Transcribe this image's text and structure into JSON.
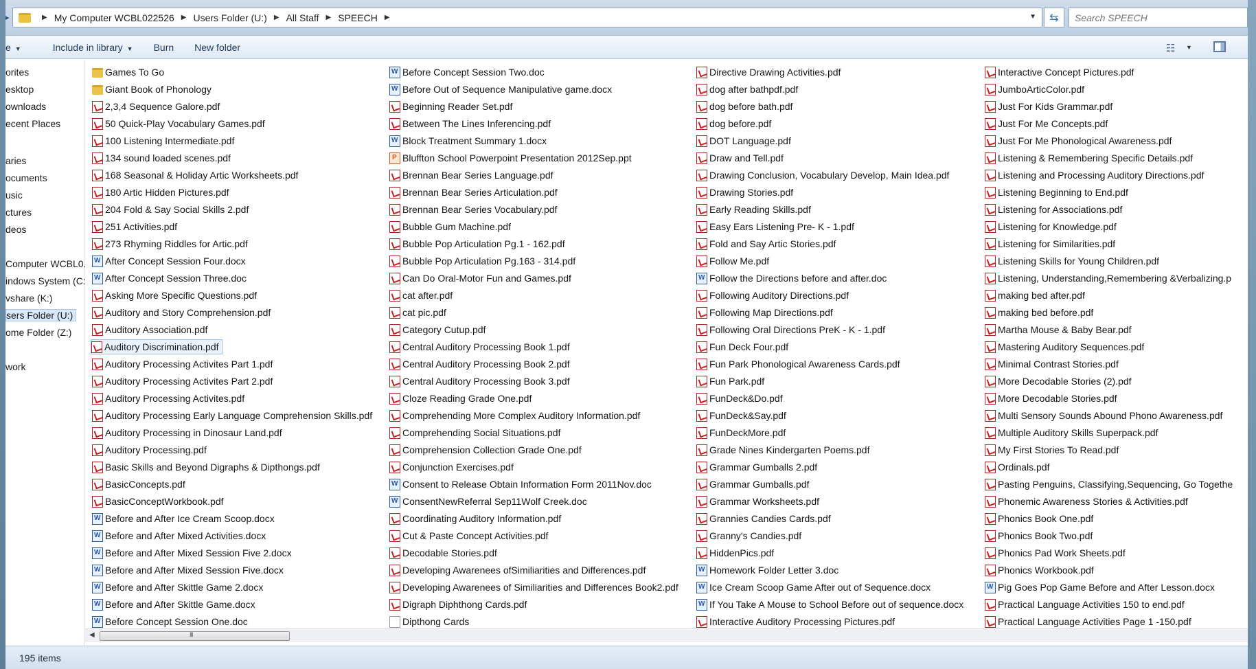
{
  "address": {
    "crumbs": [
      "My Computer WCBL022526",
      "Users Folder (U:)",
      "All Staff",
      "SPEECH"
    ],
    "search_placeholder": "Search SPEECH"
  },
  "toolbar": {
    "organize_label": "e",
    "include_label": "Include in library",
    "burn_label": "Burn",
    "new_folder_label": "New folder"
  },
  "nav": {
    "items": [
      "orites",
      "esktop",
      "ownloads",
      "ecent Places",
      "aries",
      "ocuments",
      "usic",
      "ctures",
      "deos",
      "Computer WCBL0...",
      "indows System (C:",
      "vshare (K:)",
      "sers Folder (U:)",
      "ome Folder (Z:)",
      "work"
    ]
  },
  "columns": [
    [
      {
        "n": "Games To Go",
        "t": "folder"
      },
      {
        "n": "Giant Book of Phonology",
        "t": "folder"
      },
      {
        "n": "2,3,4 Sequence Galore.pdf",
        "t": "pdf"
      },
      {
        "n": "50 Quick-Play Vocabulary Games.pdf",
        "t": "pdf"
      },
      {
        "n": "100 Listening Intermediate.pdf",
        "t": "pdf"
      },
      {
        "n": "134 sound loaded scenes.pdf",
        "t": "pdf"
      },
      {
        "n": "168 Seasonal & Holiday Artic Worksheets.pdf",
        "t": "pdf"
      },
      {
        "n": "180 Artic Hidden Pictures.pdf",
        "t": "pdf"
      },
      {
        "n": "204 Fold & Say Social Skills 2.pdf",
        "t": "pdf"
      },
      {
        "n": "251 Activities.pdf",
        "t": "pdf"
      },
      {
        "n": "273 Rhyming Riddles for Artic.pdf",
        "t": "pdf"
      },
      {
        "n": "After Concept Session Four.docx",
        "t": "doc"
      },
      {
        "n": "After Concept Session Three.doc",
        "t": "doc"
      },
      {
        "n": "Asking More Specific Questions.pdf",
        "t": "pdf"
      },
      {
        "n": "Auditory and Story Comprehension.pdf",
        "t": "pdf"
      },
      {
        "n": "Auditory Association.pdf",
        "t": "pdf"
      },
      {
        "n": "Auditory Discrimination.pdf",
        "t": "pdf",
        "selected": true
      },
      {
        "n": "Auditory Processing Activites Part 1.pdf",
        "t": "pdf"
      },
      {
        "n": "Auditory Processing Activites Part 2.pdf",
        "t": "pdf"
      },
      {
        "n": "Auditory Processing Activites.pdf",
        "t": "pdf"
      },
      {
        "n": "Auditory Processing Early Language Comprehension Skills.pdf",
        "t": "pdf"
      },
      {
        "n": "Auditory Processing in Dinosaur Land.pdf",
        "t": "pdf"
      },
      {
        "n": "Auditory Processing.pdf",
        "t": "pdf"
      },
      {
        "n": "Basic Skills and Beyond Digraphs & Dipthongs.pdf",
        "t": "pdf"
      },
      {
        "n": "BasicConcepts.pdf",
        "t": "pdf"
      },
      {
        "n": "BasicConceptWorkbook.pdf",
        "t": "pdf"
      },
      {
        "n": "Before and After Ice Cream Scoop.docx",
        "t": "doc"
      },
      {
        "n": "Before and After Mixed Activities.docx",
        "t": "doc"
      },
      {
        "n": "Before and After Mixed Session Five 2.docx",
        "t": "doc"
      },
      {
        "n": "Before and After Mixed Session Five.docx",
        "t": "doc"
      },
      {
        "n": "Before and After Skittle Game 2.docx",
        "t": "doc"
      },
      {
        "n": "Before and After Skittle Game.docx",
        "t": "doc"
      },
      {
        "n": "Before Concept Session One.doc",
        "t": "doc"
      }
    ],
    [
      {
        "n": "Before Concept Session Two.doc",
        "t": "doc"
      },
      {
        "n": "Before Out of Sequence Manipulative game.docx",
        "t": "doc"
      },
      {
        "n": "Beginning Reader Set.pdf",
        "t": "pdf"
      },
      {
        "n": "Between The Lines Inferencing.pdf",
        "t": "pdf"
      },
      {
        "n": "Block Treatment Summary 1.docx",
        "t": "doc"
      },
      {
        "n": "Bluffton School Powerpoint Presentation 2012Sep.ppt",
        "t": "ppt"
      },
      {
        "n": "Brennan Bear  Series  Language.pdf",
        "t": "pdf"
      },
      {
        "n": "Brennan Bear Series Articulation.pdf",
        "t": "pdf"
      },
      {
        "n": "Brennan Bear Series Vocabulary.pdf",
        "t": "pdf"
      },
      {
        "n": "Bubble Gum Machine.pdf",
        "t": "pdf"
      },
      {
        "n": "Bubble Pop Articulation Pg.1 - 162.pdf",
        "t": "pdf"
      },
      {
        "n": "Bubble Pop Articulation Pg.163 - 314.pdf",
        "t": "pdf"
      },
      {
        "n": "Can Do Oral-Motor Fun and Games.pdf",
        "t": "pdf"
      },
      {
        "n": "cat after.pdf",
        "t": "pdf"
      },
      {
        "n": "cat pic.pdf",
        "t": "pdf"
      },
      {
        "n": "Category Cutup.pdf",
        "t": "pdf"
      },
      {
        "n": "Central Auditory Processing Book 1.pdf",
        "t": "pdf"
      },
      {
        "n": "Central Auditory Processing Book 2.pdf",
        "t": "pdf"
      },
      {
        "n": "Central Auditory Processing Book 3.pdf",
        "t": "pdf"
      },
      {
        "n": "Cloze Reading Grade One.pdf",
        "t": "pdf"
      },
      {
        "n": "Comprehending More Complex Auditory Information.pdf",
        "t": "pdf"
      },
      {
        "n": "Comprehending Social Situations.pdf",
        "t": "pdf"
      },
      {
        "n": "Comprehension Collection Grade One.pdf",
        "t": "pdf"
      },
      {
        "n": "Conjunction Exercises.pdf",
        "t": "pdf"
      },
      {
        "n": "Consent to Release Obtain Information Form 2011Nov.doc",
        "t": "doc"
      },
      {
        "n": "ConsentNewReferral Sep11Wolf Creek.doc",
        "t": "doc"
      },
      {
        "n": "Coordinating  Auditory Information.pdf",
        "t": "pdf"
      },
      {
        "n": "Cut & Paste Concept Activities.pdf",
        "t": "pdf"
      },
      {
        "n": "Decodable Stories.pdf",
        "t": "pdf"
      },
      {
        "n": "Developing Awarenees ofSimiliarities and Differences.pdf",
        "t": "pdf"
      },
      {
        "n": "Developing Awarenees of Similiarities and Differences Book2.pdf",
        "t": "pdf"
      },
      {
        "n": "Digraph Diphthong Cards.pdf",
        "t": "pdf"
      },
      {
        "n": "Dipthong Cards",
        "t": "file"
      }
    ],
    [
      {
        "n": "Directive Drawing Activities.pdf",
        "t": "pdf"
      },
      {
        "n": "dog after bathpdf.pdf",
        "t": "pdf"
      },
      {
        "n": "dog before bath.pdf",
        "t": "pdf"
      },
      {
        "n": "dog before.pdf",
        "t": "pdf"
      },
      {
        "n": "DOT Language.pdf",
        "t": "pdf"
      },
      {
        "n": "Draw and Tell.pdf",
        "t": "pdf"
      },
      {
        "n": "Drawing Conclusion, Vocabulary Develop, Main Idea.pdf",
        "t": "pdf"
      },
      {
        "n": "Drawing Stories.pdf",
        "t": "pdf"
      },
      {
        "n": "Early Reading Skills.pdf",
        "t": "pdf"
      },
      {
        "n": "Easy Ears Listening Pre- K - 1.pdf",
        "t": "pdf"
      },
      {
        "n": "Fold and Say Artic Stories.pdf",
        "t": "pdf"
      },
      {
        "n": "Follow Me.pdf",
        "t": "pdf"
      },
      {
        "n": "Follow the Directions before and after.doc",
        "t": "doc"
      },
      {
        "n": "Following Auditory Directions.pdf",
        "t": "pdf"
      },
      {
        "n": "Following Map Directions.pdf",
        "t": "pdf"
      },
      {
        "n": "Following Oral Directions PreK - K - 1.pdf",
        "t": "pdf"
      },
      {
        "n": "Fun Deck Four.pdf",
        "t": "pdf"
      },
      {
        "n": "Fun Park Phonological Awareness Cards.pdf",
        "t": "pdf"
      },
      {
        "n": "Fun Park.pdf",
        "t": "pdf"
      },
      {
        "n": "FunDeck&Do.pdf",
        "t": "pdf"
      },
      {
        "n": "FunDeck&Say.pdf",
        "t": "pdf"
      },
      {
        "n": "FunDeckMore.pdf",
        "t": "pdf"
      },
      {
        "n": "Grade Nines Kindergarten Poems.pdf",
        "t": "pdf"
      },
      {
        "n": "Grammar Gumballs 2.pdf",
        "t": "pdf"
      },
      {
        "n": "Grammar Gumballs.pdf",
        "t": "pdf"
      },
      {
        "n": "Grammar Worksheets.pdf",
        "t": "pdf"
      },
      {
        "n": "Grannies Candies Cards.pdf",
        "t": "pdf"
      },
      {
        "n": "Granny's Candies.pdf",
        "t": "pdf"
      },
      {
        "n": "HiddenPics.pdf",
        "t": "pdf"
      },
      {
        "n": "Homework Folder Letter 3.doc",
        "t": "doc"
      },
      {
        "n": "Ice Cream Scoop Game After out of Sequence.docx",
        "t": "doc"
      },
      {
        "n": "If You Take A Mouse to School Before out of sequence.docx",
        "t": "doc"
      },
      {
        "n": "Interactive Auditory Processing Pictures.pdf",
        "t": "pdf"
      }
    ],
    [
      {
        "n": "Interactive Concept Pictures.pdf",
        "t": "pdf"
      },
      {
        "n": "JumboArticColor.pdf",
        "t": "pdf"
      },
      {
        "n": "Just For Kids Grammar.pdf",
        "t": "pdf"
      },
      {
        "n": "Just For Me Concepts.pdf",
        "t": "pdf"
      },
      {
        "n": "Just For Me Phonological Awareness.pdf",
        "t": "pdf"
      },
      {
        "n": "Listening & Remembering Specific Details.pdf",
        "t": "pdf"
      },
      {
        "n": "Listening and Processing Auditory Directions.pdf",
        "t": "pdf"
      },
      {
        "n": "Listening Beginning to End.pdf",
        "t": "pdf"
      },
      {
        "n": "Listening for Associations.pdf",
        "t": "pdf"
      },
      {
        "n": "Listening for Knowledge.pdf",
        "t": "pdf"
      },
      {
        "n": "Listening for Similarities.pdf",
        "t": "pdf"
      },
      {
        "n": "Listening Skills for Young Children.pdf",
        "t": "pdf"
      },
      {
        "n": "Listening, Understanding,Remembering &Verbalizing.p",
        "t": "pdf"
      },
      {
        "n": "making bed after.pdf",
        "t": "pdf"
      },
      {
        "n": "making bed before.pdf",
        "t": "pdf"
      },
      {
        "n": "Martha Mouse & Baby Bear.pdf",
        "t": "pdf"
      },
      {
        "n": "Mastering Auditory Sequences.pdf",
        "t": "pdf"
      },
      {
        "n": "Minimal Contrast Stories.pdf",
        "t": "pdf"
      },
      {
        "n": "More Decodable Stories (2).pdf",
        "t": "pdf"
      },
      {
        "n": "More Decodable Stories.pdf",
        "t": "pdf"
      },
      {
        "n": "Multi Sensory Sounds Abound Phono Awareness.pdf",
        "t": "pdf"
      },
      {
        "n": "Multiple Auditory Skills Superpack.pdf",
        "t": "pdf"
      },
      {
        "n": "My First Stories To Read.pdf",
        "t": "pdf"
      },
      {
        "n": "Ordinals.pdf",
        "t": "pdf"
      },
      {
        "n": "Pasting Penguins, Classifying,Sequencing, Go Togethe",
        "t": "pdf"
      },
      {
        "n": "Phonemic Awareness Stories & Activities.pdf",
        "t": "pdf"
      },
      {
        "n": "Phonics Book One.pdf",
        "t": "pdf"
      },
      {
        "n": "Phonics Book Two.pdf",
        "t": "pdf"
      },
      {
        "n": "Phonics Pad Work Sheets.pdf",
        "t": "pdf"
      },
      {
        "n": "Phonics Workbook.pdf",
        "t": "pdf"
      },
      {
        "n": "Pig Goes Pop Game Before and After Lesson.docx",
        "t": "doc"
      },
      {
        "n": "Practical Language Activities  150 to end.pdf",
        "t": "pdf"
      },
      {
        "n": "Practical Language Activities Page 1 -150.pdf",
        "t": "pdf"
      }
    ]
  ],
  "scrollbar": {
    "grip": "III"
  },
  "status": {
    "items_count": "195 items"
  }
}
